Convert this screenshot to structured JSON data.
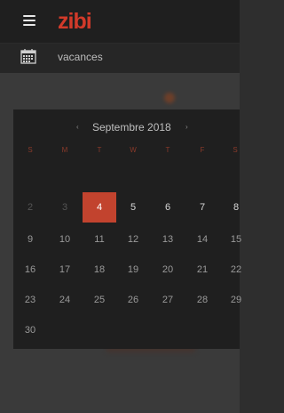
{
  "topbar": {
    "logo_text": "zibi"
  },
  "subbar": {
    "title": "vacances"
  },
  "datepicker": {
    "month_label": "Septembre 2018",
    "prev": "‹",
    "next": "›",
    "weekdays": [
      "S",
      "M",
      "T",
      "W",
      "T",
      "F",
      "S"
    ],
    "weeks": [
      [
        "2",
        "3",
        "4",
        "5",
        "6",
        "7",
        "8"
      ],
      [
        "9",
        "10",
        "11",
        "12",
        "13",
        "14",
        "15"
      ],
      [
        "16",
        "17",
        "18",
        "19",
        "20",
        "21",
        "22"
      ],
      [
        "23",
        "24",
        "25",
        "26",
        "27",
        "28",
        "29"
      ],
      [
        "30"
      ]
    ],
    "selected_day": "4"
  },
  "colors": {
    "accent": "#c2432e",
    "logo": "#d23a2a",
    "background": "#1f1f1f"
  }
}
